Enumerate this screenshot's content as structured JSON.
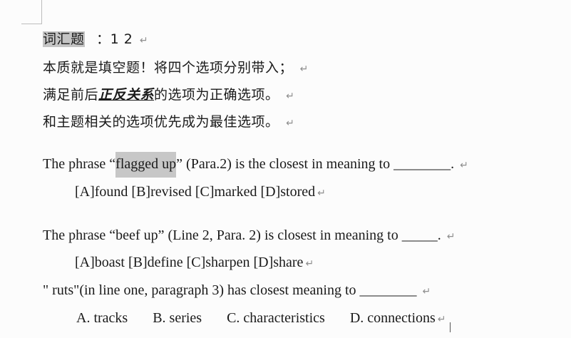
{
  "heading": {
    "label": "词汇题",
    "value": "：1 2"
  },
  "tips": [
    "本质就是填空题！将四个选项分别带入；",
    {
      "before": "满足前后",
      "emph": "正反关系",
      "after": "的选项为正确选项。"
    },
    "和主题相关的选项优先成为最佳选项。"
  ],
  "questions": [
    {
      "pre": "The phrase “",
      "highlight": "flagged up",
      "post": "” (Para.2) is the closest in meaning to ________.",
      "options": "[A]found [B]revised [C]marked [D]stored"
    },
    {
      "text": "The phrase “beef up” (Line 2, Para. 2) is closest in meaning to _____.",
      "options": "[A]boast [B]define [C]sharpen [D]share"
    },
    {
      "text": "\" ruts\"(in line one, paragraph 3) has closest meaning to ________",
      "options": [
        "A. tracks",
        "B. series",
        "C. characteristics",
        "D. connections"
      ]
    }
  ],
  "return_mark": "↵"
}
